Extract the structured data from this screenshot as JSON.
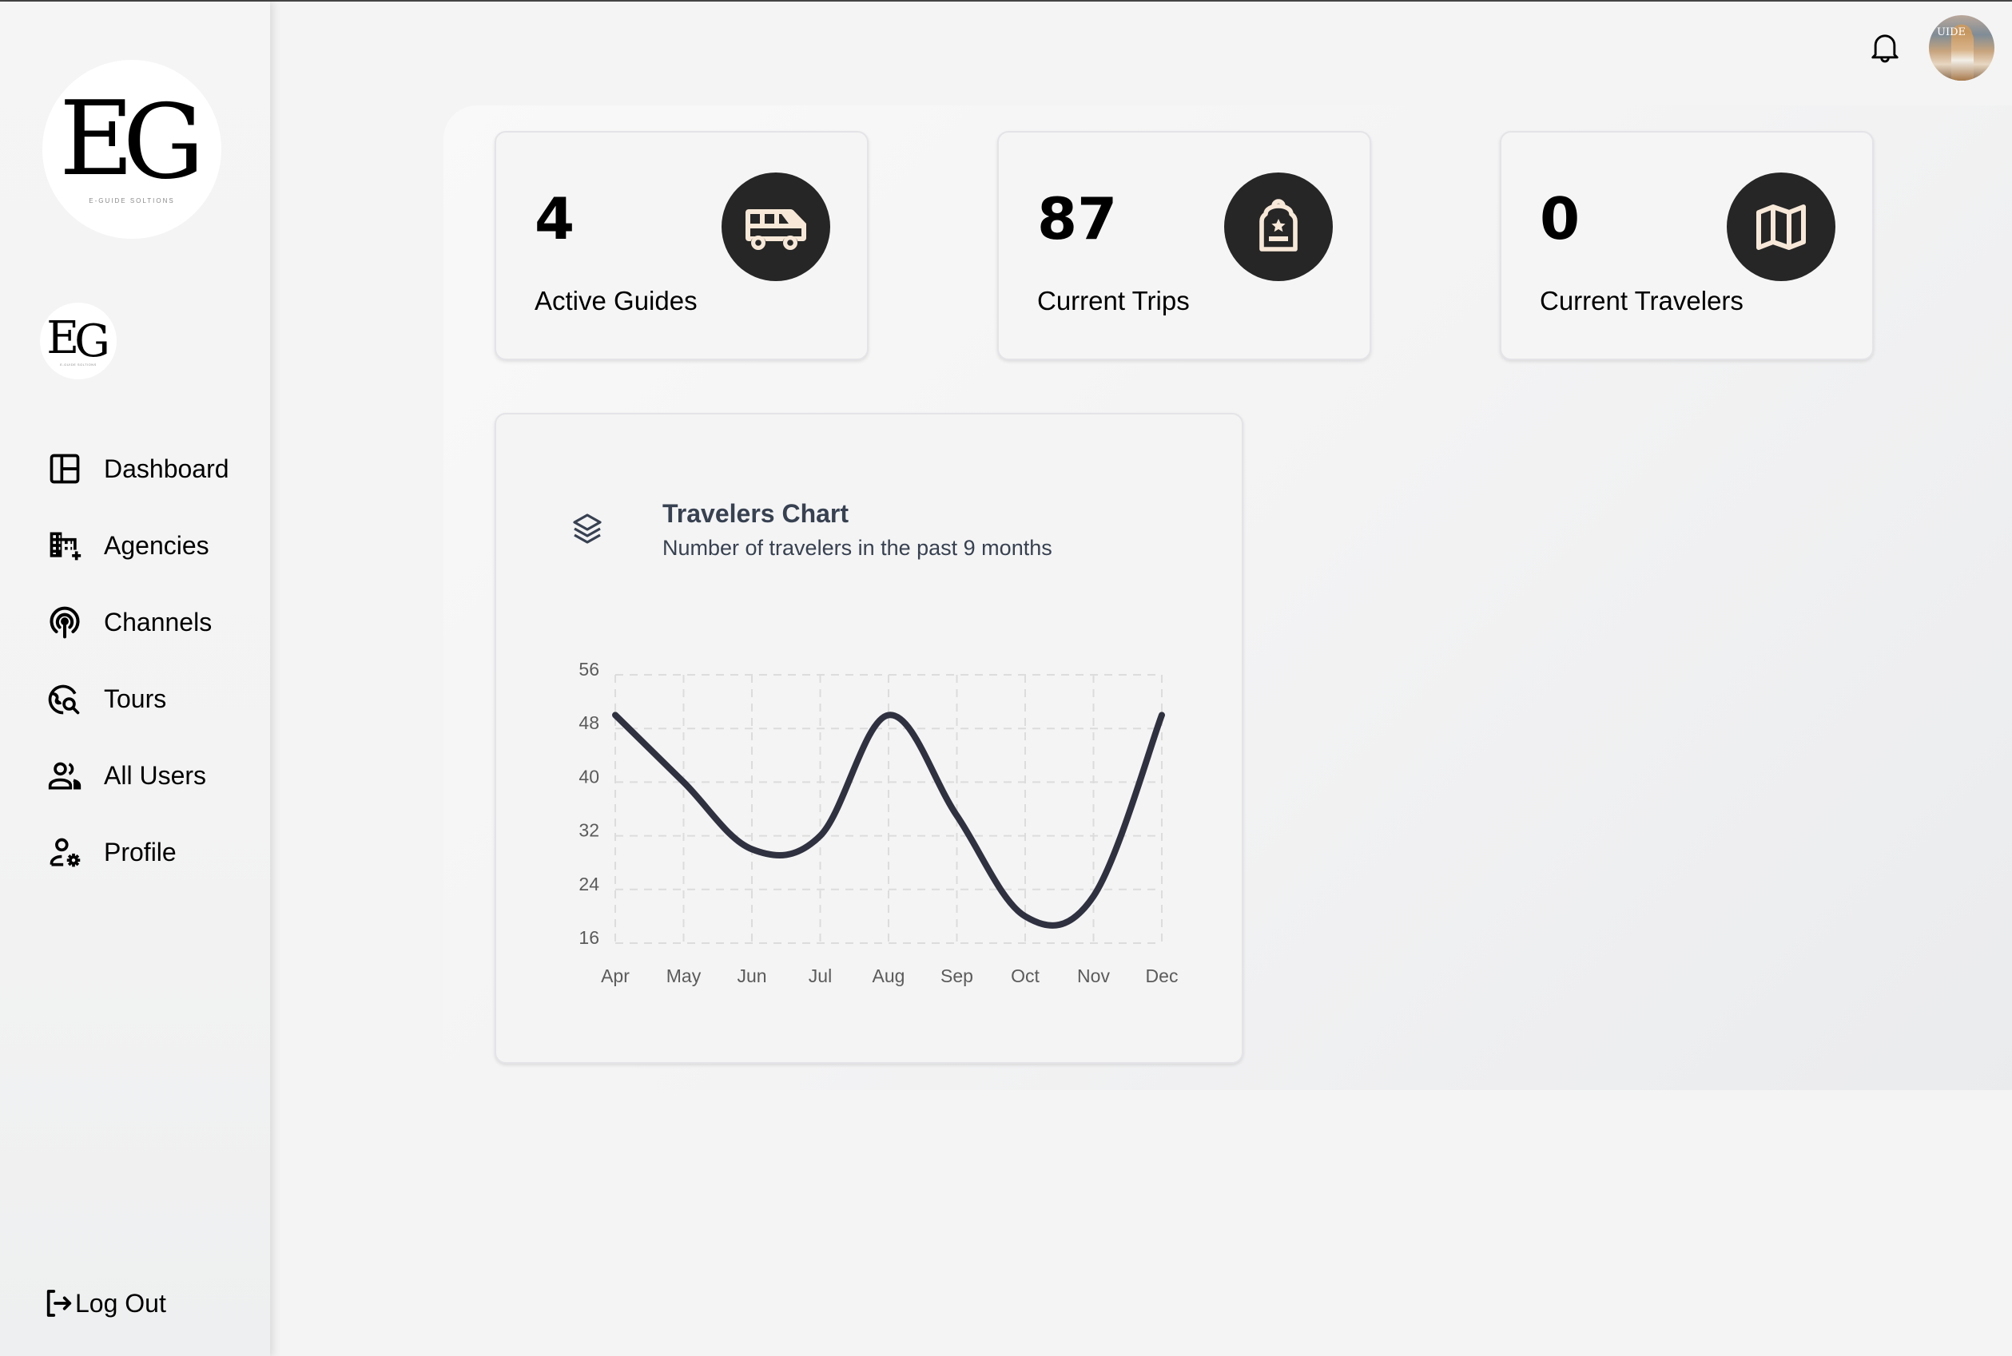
{
  "brand": {
    "monogram": "EG",
    "tagline": "E-GUIDE SOLTIONS"
  },
  "sidebar": {
    "items": [
      {
        "label": "Dashboard",
        "icon": "dashboard-icon"
      },
      {
        "label": "Agencies",
        "icon": "building-add-icon"
      },
      {
        "label": "Channels",
        "icon": "broadcast-icon"
      },
      {
        "label": "Tours",
        "icon": "globe-search-icon"
      },
      {
        "label": "All Users",
        "icon": "users-icon"
      },
      {
        "label": "Profile",
        "icon": "user-settings-icon"
      }
    ],
    "logout_label": "Log Out"
  },
  "topbar": {
    "notifications_icon": "bell-icon",
    "avatar_text": "UIDE"
  },
  "stats": [
    {
      "value": "4",
      "label": "Active Guides",
      "icon": "van-icon"
    },
    {
      "value": "87",
      "label": "Current Trips",
      "icon": "backpack-icon"
    },
    {
      "value": "0",
      "label": "Current Travelers",
      "icon": "map-icon"
    }
  ],
  "colors": {
    "badge_bg": "#262626",
    "badge_icon": "#f7e8d8",
    "line": "#2f3140",
    "heading": "#374151"
  },
  "chart_data": {
    "type": "line",
    "title": "Travelers Chart",
    "subtitle": "Number of travelers in the past 9 months",
    "categories": [
      "Apr",
      "May",
      "Jun",
      "Jul",
      "Aug",
      "Sep",
      "Oct",
      "Nov",
      "Dec"
    ],
    "series": [
      {
        "name": "Travelers",
        "values": [
          50,
          40,
          30,
          32,
          50,
          35,
          20,
          23,
          50
        ]
      }
    ],
    "yticks": [
      16,
      24,
      32,
      40,
      48,
      56
    ],
    "ylim": [
      16,
      56
    ],
    "xlabel": "",
    "ylabel": "",
    "grid": true,
    "legend": "none",
    "curve": "smooth"
  }
}
